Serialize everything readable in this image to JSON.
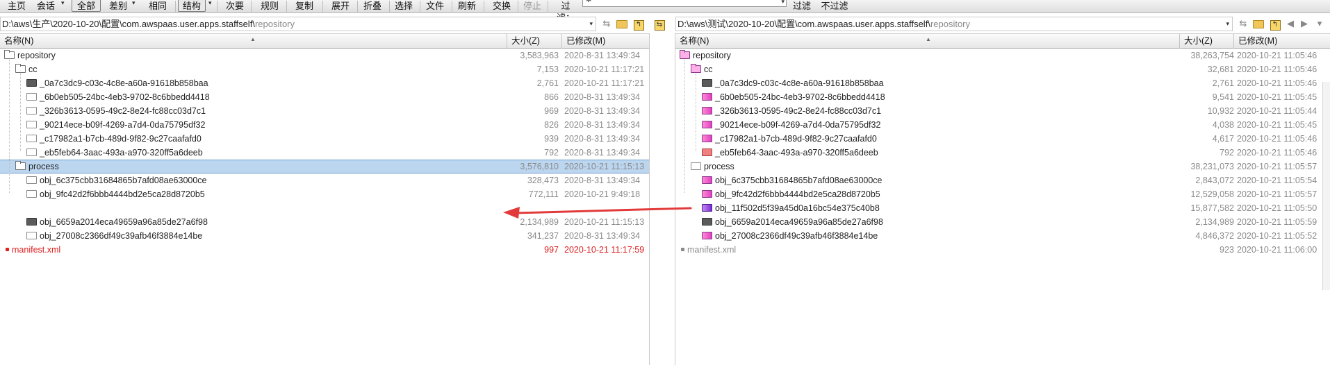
{
  "toolbar": {
    "home": "主页",
    "session": "会话",
    "all": "全部",
    "diffs": "差别",
    "same": "相同",
    "structure": "结构",
    "minor": "次要",
    "rules": "规则",
    "copy": "复制",
    "expand": "展开",
    "collapse": "折叠",
    "select": "选择",
    "file": "文件",
    "refresh": "刷新",
    "swap": "交换",
    "stop": "停止",
    "filter_label": "过滤：",
    "filter_button": "过滤",
    "no_filter": "不过滤"
  },
  "left": {
    "path_prefix": "D:\\aws\\生产\\2020-10-20\\配置\\com.awspaas.user.apps.staffself\\",
    "path_suffix": "repository",
    "headers": {
      "name": "名称(N)",
      "size": "大小(Z)",
      "modified": "已修改(M)"
    },
    "rows": [
      {
        "name": "repository",
        "size": "3,583,963",
        "date": "2020-8-31 13:49:34"
      },
      {
        "name": "cc",
        "size": "7,153",
        "date": "2020-10-21 11:17:21"
      },
      {
        "name": "_0a7c3dc9-c03c-4c8e-a60a-91618b858baa",
        "size": "2,761",
        "date": "2020-10-21 11:17:21"
      },
      {
        "name": "_6b0eb505-24bc-4eb3-9702-8c6bbedd4418",
        "size": "866",
        "date": "2020-8-31 13:49:34"
      },
      {
        "name": "_326b3613-0595-49c2-8e24-fc88cc03d7c1",
        "size": "969",
        "date": "2020-8-31 13:49:34"
      },
      {
        "name": "_90214ece-b09f-4269-a7d4-0da75795df32",
        "size": "826",
        "date": "2020-8-31 13:49:34"
      },
      {
        "name": "_c17982a1-b7cb-489d-9f82-9c27caafafd0",
        "size": "939",
        "date": "2020-8-31 13:49:34"
      },
      {
        "name": "_eb5feb64-3aac-493a-a970-320ff5a6deeb",
        "size": "792",
        "date": "2020-8-31 13:49:34"
      },
      {
        "name": "process",
        "size": "3,576,810",
        "date": "2020-10-21 11:15:13"
      },
      {
        "name": "obj_6c375cbb31684865b7afd08ae63000ce",
        "size": "328,473",
        "date": "2020-8-31 13:49:34"
      },
      {
        "name": "obj_9fc42d2f6bbb4444bd2e5ca28d8720b5",
        "size": "772,111",
        "date": "2020-10-21 9:49:18"
      },
      {
        "name": "",
        "size": "",
        "date": ""
      },
      {
        "name": "obj_6659a2014eca49659a96a85de27a6f98",
        "size": "2,134,989",
        "date": "2020-10-21 11:15:13"
      },
      {
        "name": "obj_27008c2366df49c39afb46f3884e14be",
        "size": "341,237",
        "date": "2020-8-31 13:49:34"
      },
      {
        "name": "manifest.xml",
        "size": "997",
        "date": "2020-10-21 11:17:59"
      }
    ]
  },
  "right": {
    "path_prefix": "D:\\aws\\测试\\2020-10-20\\配置\\com.awspaas.user.apps.staffself\\",
    "path_suffix": "repository",
    "headers": {
      "name": "名称(N)",
      "size": "大小(Z)",
      "modified": "已修改(M)"
    },
    "rows": [
      {
        "name": "repository",
        "size": "38,263,754",
        "date": "2020-10-21 11:05:46"
      },
      {
        "name": "cc",
        "size": "32,681",
        "date": "2020-10-21 11:05:46"
      },
      {
        "name": "_0a7c3dc9-c03c-4c8e-a60a-91618b858baa",
        "size": "2,761",
        "date": "2020-10-21 11:05:46"
      },
      {
        "name": "_6b0eb505-24bc-4eb3-9702-8c6bbedd4418",
        "size": "9,541",
        "date": "2020-10-21 11:05:45"
      },
      {
        "name": "_326b3613-0595-49c2-8e24-fc88cc03d7c1",
        "size": "10,932",
        "date": "2020-10-21 11:05:44"
      },
      {
        "name": "_90214ece-b09f-4269-a7d4-0da75795df32",
        "size": "4,038",
        "date": "2020-10-21 11:05:45"
      },
      {
        "name": "_c17982a1-b7cb-489d-9f82-9c27caafafd0",
        "size": "4,617",
        "date": "2020-10-21 11:05:46"
      },
      {
        "name": "_eb5feb64-3aac-493a-a970-320ff5a6deeb",
        "size": "792",
        "date": "2020-10-21 11:05:46"
      },
      {
        "name": "process",
        "size": "38,231,073",
        "date": "2020-10-21 11:05:57"
      },
      {
        "name": "obj_6c375cbb31684865b7afd08ae63000ce",
        "size": "2,843,072",
        "date": "2020-10-21 11:05:54"
      },
      {
        "name": "obj_9fc42d2f6bbb4444bd2e5ca28d8720b5",
        "size": "12,529,058",
        "date": "2020-10-21 11:05:57"
      },
      {
        "name": "obj_11f502d5f39a45d0a16bc54e375c40b8",
        "size": "15,877,582",
        "date": "2020-10-21 11:05:50"
      },
      {
        "name": "obj_6659a2014eca49659a96a85de27a6f98",
        "size": "2,134,989",
        "date": "2020-10-21 11:05:59"
      },
      {
        "name": "obj_27008c2366df49c39afb46f3884e14be",
        "size": "4,846,372",
        "date": "2020-10-21 11:05:52"
      },
      {
        "name": "manifest.xml",
        "size": "923",
        "date": "2020-10-21 11:06:00"
      }
    ]
  },
  "annotation": {
    "arrow_color": "#e23a3a"
  },
  "colors": {
    "selection": "#bcd6f0",
    "orphan_left": "#e02020",
    "muted": "#8a8a8a"
  }
}
